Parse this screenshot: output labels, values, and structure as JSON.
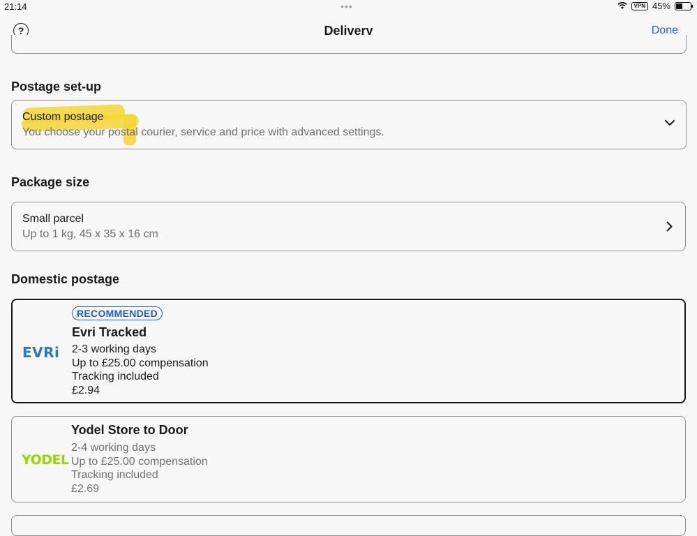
{
  "status_bar": {
    "time": "21:14",
    "dots": "•••",
    "vpn": "VPN",
    "battery": "45%"
  },
  "nav": {
    "help_icon": "question-circle-icon",
    "title": "Delivery",
    "done_label": "Done"
  },
  "postage_setup": {
    "heading": "Postage set-up",
    "value": "Custom postage",
    "description": "You choose your postal courier, service and price with advanced settings.",
    "highlight_color": "#f5d634"
  },
  "package_size": {
    "heading": "Package size",
    "value": "Small parcel",
    "description": "Up to 1 kg, 45 x 35 x 16 cm"
  },
  "domestic_postage": {
    "heading": "Domestic postage",
    "options": [
      {
        "logo_text": "EVRi",
        "badge": "RECOMMENDED",
        "title": "Evri Tracked",
        "days": "2-3 working days",
        "compensation": "Up to £25.00 compensation",
        "tracking": "Tracking included",
        "price": "£2.94",
        "selected": true
      },
      {
        "logo_text": "YODEL",
        "title": "Yodel Store to Door",
        "days": "2-4 working days",
        "compensation": "Up to £25.00 compensation",
        "tracking": "Tracking included",
        "price": "£2.69",
        "selected": false
      }
    ]
  },
  "colors": {
    "accent": "#1b5fce",
    "evri": "#2a79c1",
    "yodel": "#9cd400"
  }
}
